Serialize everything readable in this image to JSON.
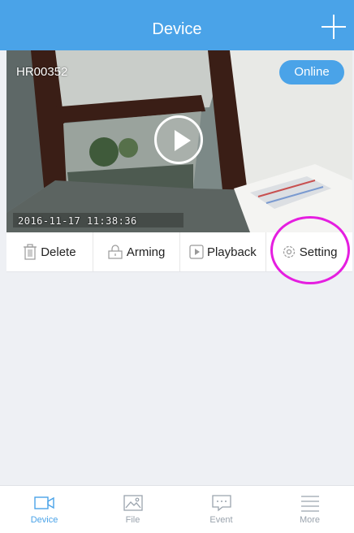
{
  "header": {
    "title": "Device"
  },
  "device": {
    "id": "HR00352",
    "status": "Online",
    "timestamp": "2016-11-17  11:38:36"
  },
  "actions": {
    "delete": "Delete",
    "arming": "Arming",
    "playback": "Playback",
    "setting": "Setting"
  },
  "tabs": [
    {
      "label": "Device",
      "icon": "camera-icon",
      "active": true
    },
    {
      "label": "File",
      "icon": "image-icon",
      "active": false
    },
    {
      "label": "Event",
      "icon": "chat-icon",
      "active": false
    },
    {
      "label": "More",
      "icon": "list-icon",
      "active": false
    }
  ],
  "colors": {
    "accent": "#4aa3e8",
    "highlight": "#e51ee0"
  }
}
